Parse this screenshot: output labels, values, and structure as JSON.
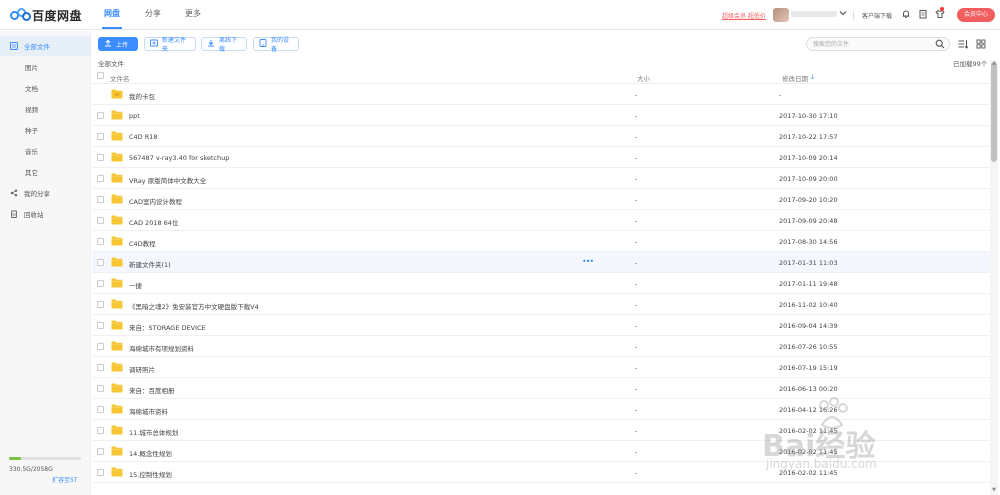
{
  "header": {
    "logo_text": "百度网盘",
    "tabs": [
      {
        "label": "网盘",
        "active": true
      },
      {
        "label": "分享",
        "active": false
      },
      {
        "label": "更多",
        "active": false
      }
    ],
    "promo_link": "超级会员 超低价",
    "client_download": "客户端下载",
    "member_center": "会员中心"
  },
  "sidebar": {
    "items": [
      {
        "label": "全部文件",
        "icon": "folder-icon",
        "active": true
      },
      {
        "label": "图片"
      },
      {
        "label": "文档"
      },
      {
        "label": "视频"
      },
      {
        "label": "种子"
      },
      {
        "label": "音乐"
      },
      {
        "label": "其它"
      },
      {
        "label": "我的分享",
        "icon": "share-icon"
      },
      {
        "label": "回收站",
        "icon": "trash-icon"
      }
    ],
    "quota_text": "330.5G/2058G",
    "quota_fraction": 0.16,
    "expand_link": "扩容至5T"
  },
  "toolbar": {
    "upload": "上传",
    "new_folder": "新建文件夹",
    "offline_download": "离线下载",
    "my_devices": "我的设备",
    "search_placeholder": "搜索您的文件"
  },
  "breadcrumb": "全部文件",
  "loaded_count": "已加载99个",
  "table": {
    "col_name": "文件名",
    "col_size": "大小",
    "col_date": "修改日期",
    "sort_arrow": "↓",
    "rows": [
      {
        "name": "我的卡包",
        "size": "-",
        "date": "-",
        "special": true
      },
      {
        "name": "ppt",
        "size": "-",
        "date": "2017-10-30 17:10"
      },
      {
        "name": "C4D R18",
        "size": "-",
        "date": "2017-10-22 17:57"
      },
      {
        "name": "567487 v-ray3.40 for sketchup",
        "size": "-",
        "date": "2017-10-09 20:14"
      },
      {
        "name": "VRay 原版简体中文教大全",
        "size": "-",
        "date": "2017-10-09 20:00"
      },
      {
        "name": "CAD室内设计教程",
        "size": "-",
        "date": "2017-09-20 10:20"
      },
      {
        "name": "CAD 2018 64位",
        "size": "-",
        "date": "2017-09-09 20:48"
      },
      {
        "name": "C4D教程",
        "size": "-",
        "date": "2017-08-30 14:56"
      },
      {
        "name": "新建文件夹(1)",
        "size": "-",
        "date": "2017-01-31 11:03",
        "hover": true
      },
      {
        "name": "一捷",
        "size": "-",
        "date": "2017-01-11 19:48"
      },
      {
        "name": "《黑暗之魂2》免安装官方中文硬盘版下载V4",
        "size": "-",
        "date": "2016-11-02 10:40"
      },
      {
        "name": "来自：STORAGE DEVICE",
        "size": "-",
        "date": "2016-09-04 14:39"
      },
      {
        "name": "海绵城市有项规划资料",
        "size": "-",
        "date": "2016-07-26 10:55"
      },
      {
        "name": "调研照片",
        "size": "-",
        "date": "2016-07-19 15:19"
      },
      {
        "name": "来自：百度相册",
        "size": "-",
        "date": "2016-06-13 00:20"
      },
      {
        "name": "海绵城市资料",
        "size": "-",
        "date": "2016-04-12 16:26"
      },
      {
        "name": "11.城市总体规划",
        "size": "-",
        "date": "2016-02-02 11:45"
      },
      {
        "name": "14.概念性规划",
        "size": "-",
        "date": "2016-02-02 11:45"
      },
      {
        "name": "15.控制性规划",
        "size": "-",
        "date": "2016-02-02 11:45"
      }
    ]
  },
  "watermark": {
    "text": "Bai经验",
    "url": "jingyan.baidu.com"
  },
  "colors": {
    "accent": "#3b8cff",
    "member": "#f25d5d",
    "folder": "#f7c531",
    "quota": "#7ac144"
  }
}
